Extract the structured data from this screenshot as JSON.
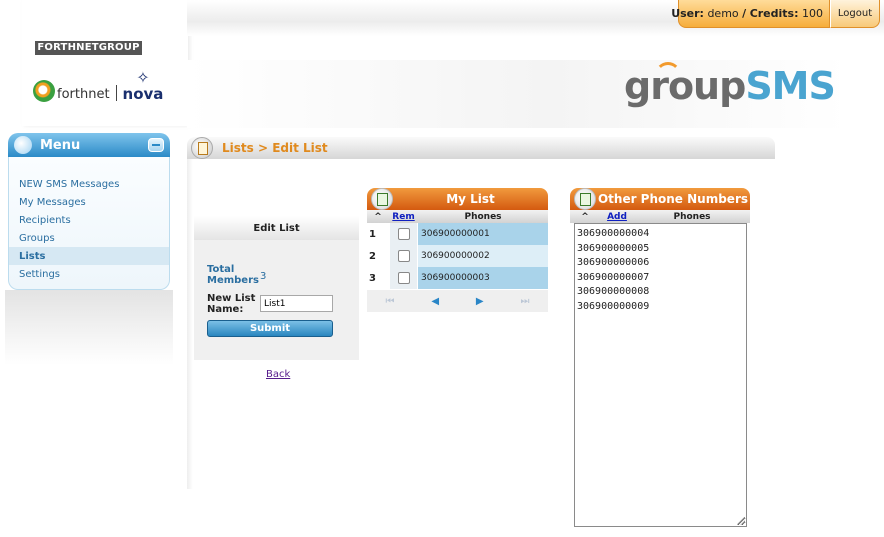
{
  "header": {
    "user_label": "User:",
    "user_name": "demo",
    "credits_label": "Credits:",
    "credits_value": "100",
    "logout": "Logout"
  },
  "brand": {
    "group_name": "FORTHNETGROUP",
    "forthnet": "forthnet",
    "nova": "nova",
    "product_part1": "group",
    "product_part2": "SMS"
  },
  "menu": {
    "title": "Menu",
    "items": [
      {
        "label": "NEW SMS Messages"
      },
      {
        "label": "My Messages"
      },
      {
        "label": "Recipients"
      },
      {
        "label": "Groups"
      },
      {
        "label": "Lists"
      },
      {
        "label": "Settings"
      }
    ]
  },
  "page": {
    "breadcrumb": "Lists > Edit List"
  },
  "edit_list": {
    "title": "Edit List",
    "total_members_label": "Total Members",
    "total_members_value": "3",
    "name_label": "New List Name:",
    "name_value": "List1",
    "submit": "Submit",
    "back": "Back"
  },
  "my_list": {
    "title": "My List",
    "col_sort": "^",
    "col_rem": "Rem",
    "col_phones": "Phones",
    "rows": [
      {
        "idx": "1",
        "phone": "306900000001"
      },
      {
        "idx": "2",
        "phone": "306900000002"
      },
      {
        "idx": "3",
        "phone": "306900000003"
      }
    ],
    "pager": {
      "first": "⏮",
      "prev": "◀",
      "next": "▶",
      "last": "⏭"
    }
  },
  "other_numbers": {
    "title": "Other Phone Numbers",
    "col_sort": "^",
    "col_add": "Add",
    "col_phones": "Phones",
    "numbers": [
      "306900000004",
      "306900000005",
      "306900000006",
      "306900000007",
      "306900000008",
      "306900000009"
    ]
  }
}
